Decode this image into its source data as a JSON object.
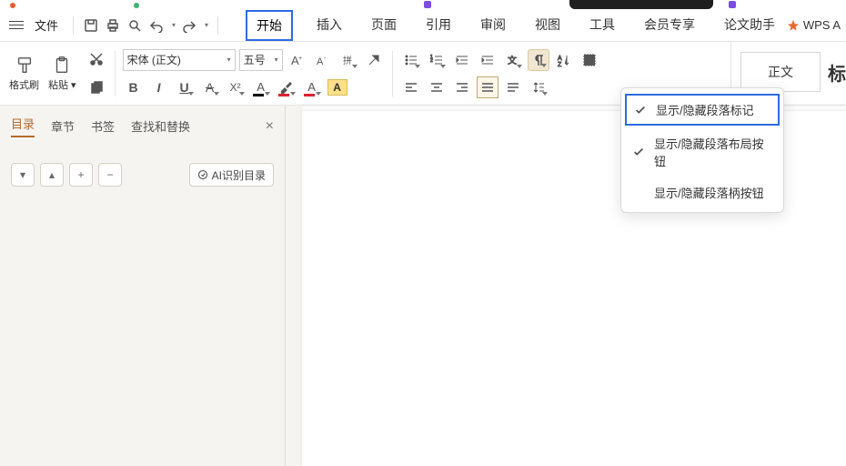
{
  "menubar": {
    "file": "文件",
    "tabs": [
      "开始",
      "插入",
      "页面",
      "引用",
      "审阅",
      "视图",
      "工具",
      "会员专享",
      "论文助手"
    ],
    "active_tab": 0,
    "wps_ai": "WPS A"
  },
  "ribbon": {
    "format_painter": "格式刷",
    "paste": "粘贴",
    "font_name": "宋体 (正文)",
    "font_size": "五号",
    "char_a": "A",
    "styles": {
      "normal": "正文",
      "heading": "标"
    }
  },
  "dropdown": {
    "item1": "显示/隐藏段落标记",
    "item2": "显示/隐藏段落布局按钮",
    "item3": "显示/隐藏段落柄按钮"
  },
  "sidepanel": {
    "tab_toc": "目录",
    "tab_chapter": "章节",
    "tab_bookmark": "书签",
    "tab_findrep": "查找和替换",
    "ai_toc": "AI识别目录"
  }
}
